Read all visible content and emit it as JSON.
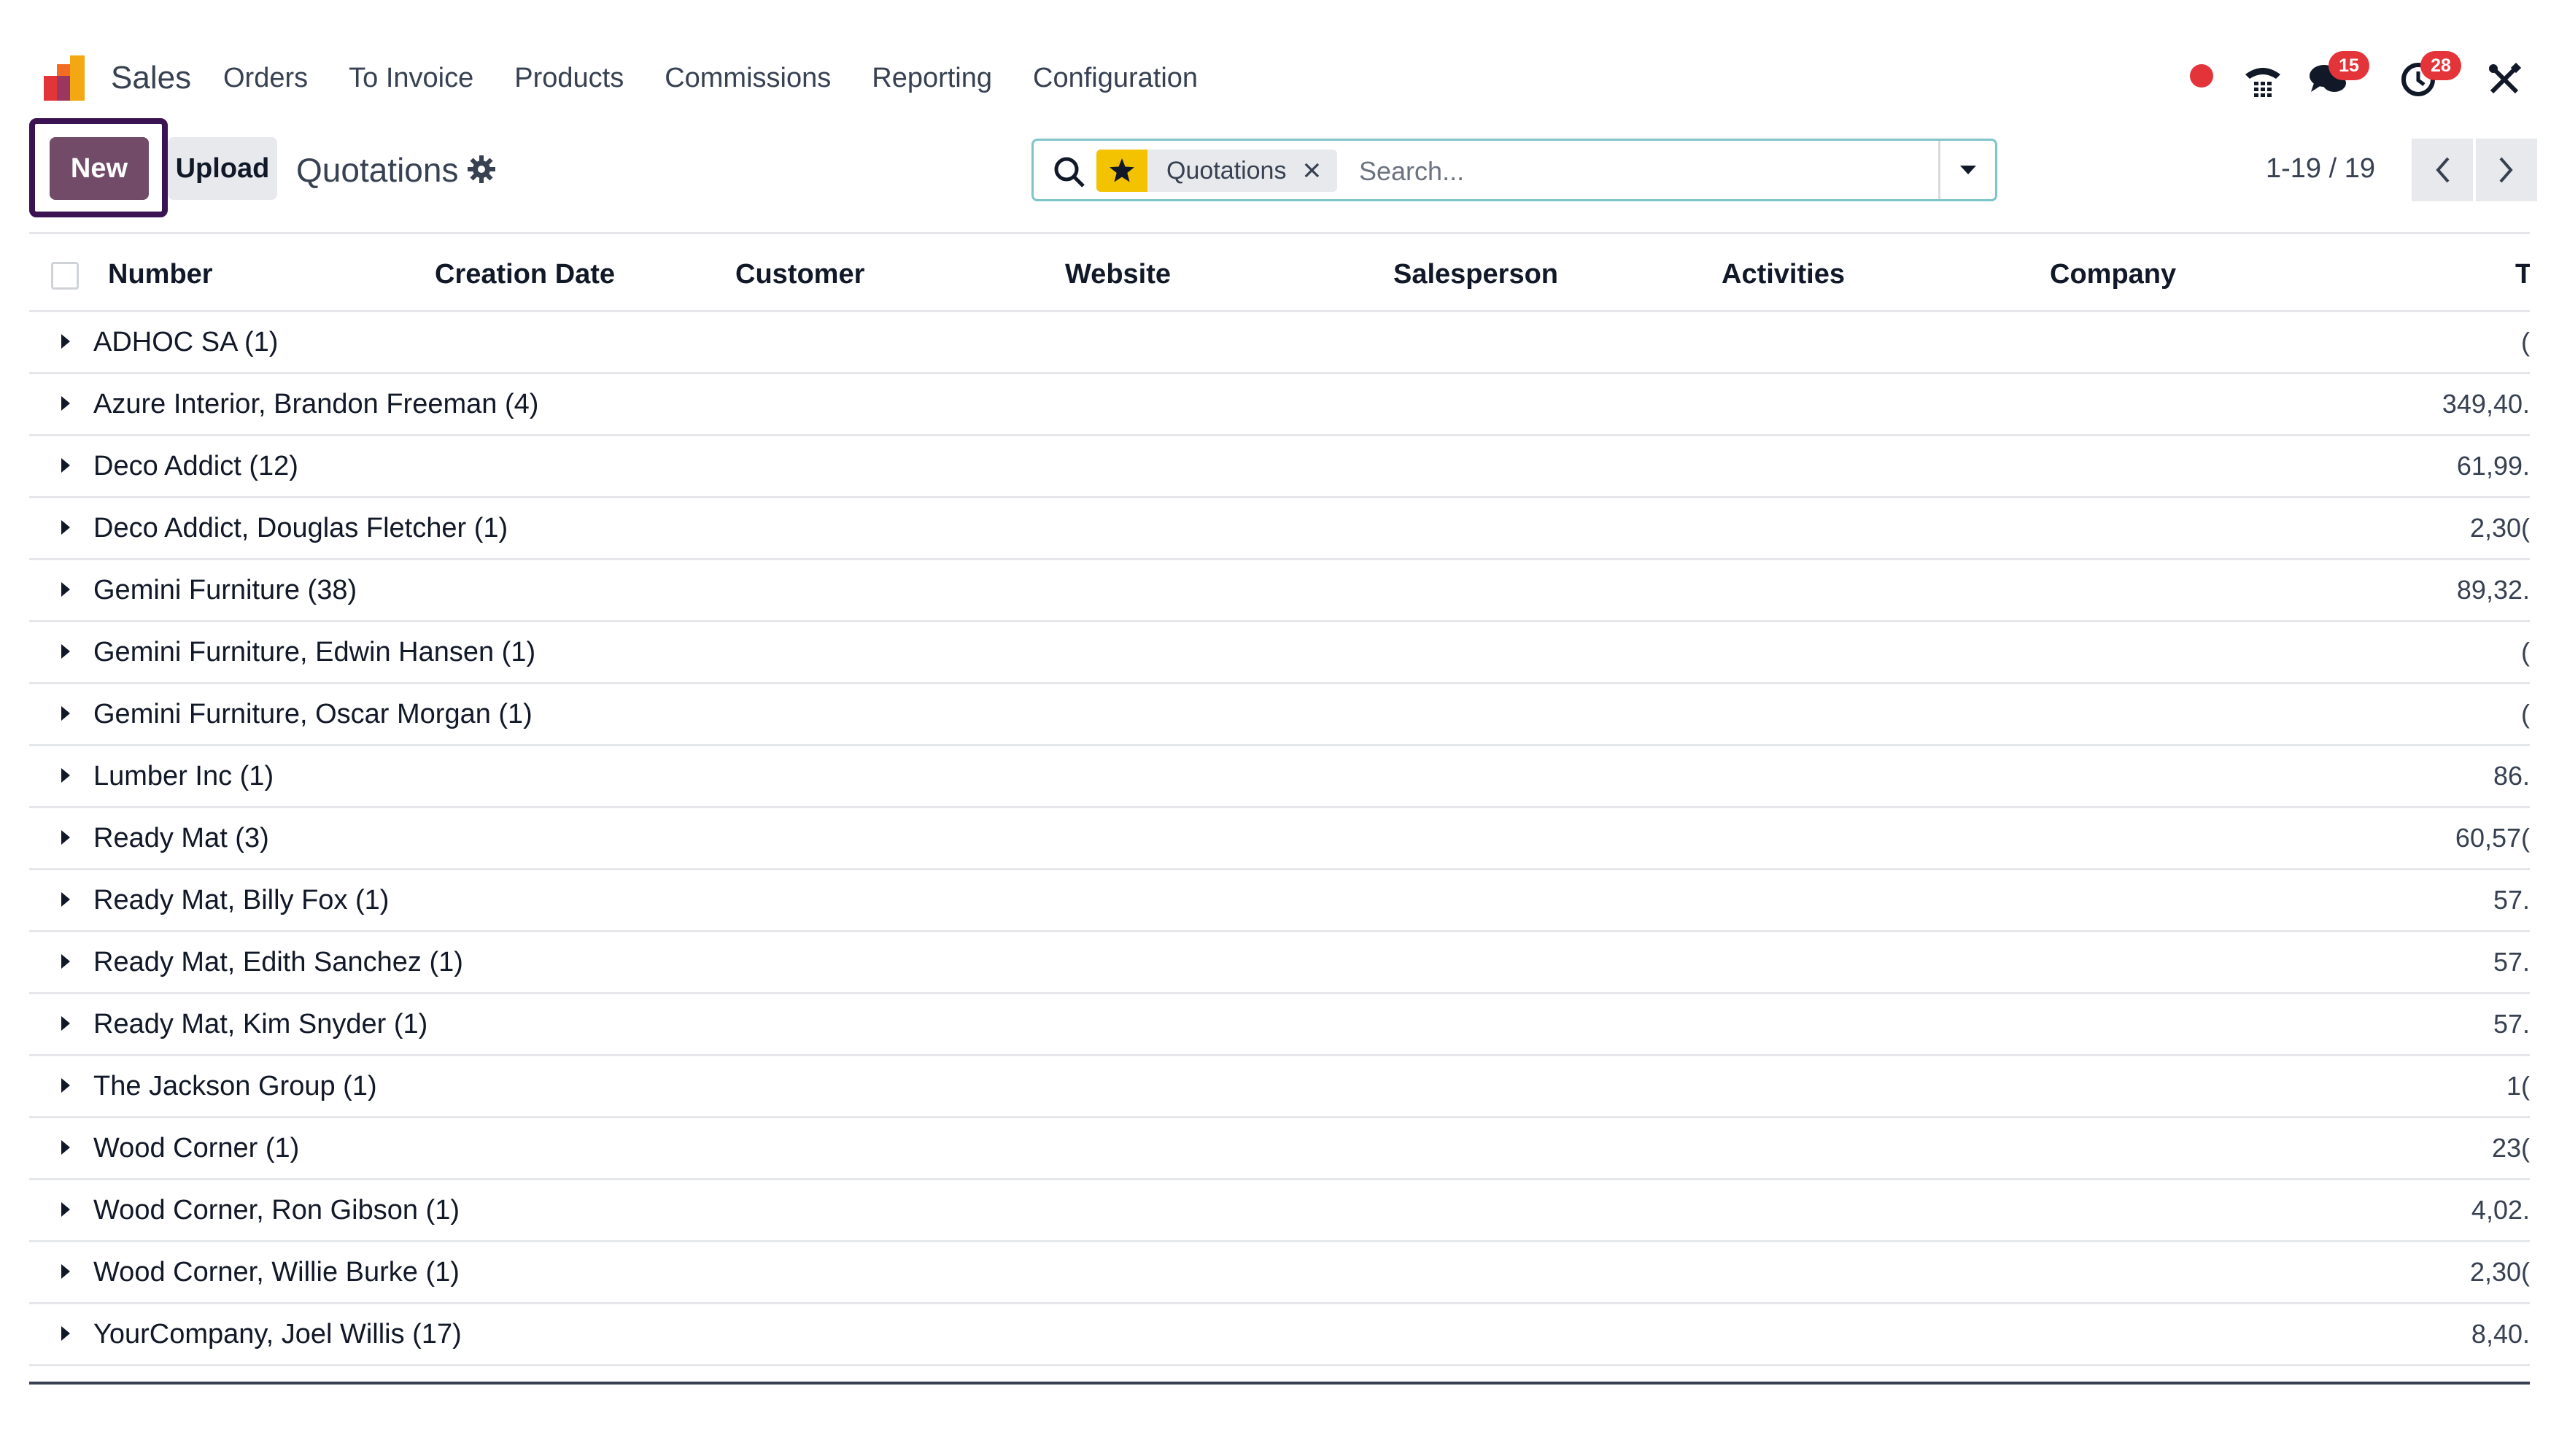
{
  "navbar": {
    "app_name": "Sales",
    "menu": [
      "Orders",
      "To Invoice",
      "Products",
      "Commissions",
      "Reporting",
      "Configuration"
    ],
    "messages_badge": "15",
    "activities_badge": "28",
    "icons": [
      "app-logo-icon",
      "record-dot-icon",
      "phone-icon",
      "chat-icon",
      "clock-icon",
      "tools-icon"
    ]
  },
  "control_panel": {
    "new_label": "New",
    "upload_label": "Upload",
    "title": "Quotations",
    "search": {
      "facet_label": "Quotations",
      "placeholder": "Search..."
    },
    "pager": "1-19 / 19"
  },
  "list": {
    "columns": [
      "Number",
      "Creation Date",
      "Customer",
      "Website",
      "Salesperson",
      "Activities",
      "Company",
      "T"
    ],
    "groups": [
      {
        "label": "ADHOC SA (1)",
        "total": "("
      },
      {
        "label": "Azure Interior, Brandon Freeman (4)",
        "total": "349,40."
      },
      {
        "label": "Deco Addict (12)",
        "total": "61,99."
      },
      {
        "label": "Deco Addict, Douglas Fletcher (1)",
        "total": "2,30("
      },
      {
        "label": "Gemini Furniture (38)",
        "total": "89,32."
      },
      {
        "label": "Gemini Furniture, Edwin Hansen (1)",
        "total": "("
      },
      {
        "label": "Gemini Furniture, Oscar Morgan (1)",
        "total": "("
      },
      {
        "label": "Lumber Inc (1)",
        "total": "86."
      },
      {
        "label": "Ready Mat (3)",
        "total": "60,57("
      },
      {
        "label": "Ready Mat, Billy Fox (1)",
        "total": "57."
      },
      {
        "label": "Ready Mat, Edith Sanchez (1)",
        "total": "57."
      },
      {
        "label": "Ready Mat, Kim Snyder (1)",
        "total": "57."
      },
      {
        "label": "The Jackson Group (1)",
        "total": "1("
      },
      {
        "label": "Wood Corner (1)",
        "total": "23("
      },
      {
        "label": "Wood Corner, Ron Gibson (1)",
        "total": "4,02."
      },
      {
        "label": "Wood Corner, Willie Burke (1)",
        "total": "2,30("
      },
      {
        "label": "YourCompany, Joel Willis (17)",
        "total": "8,40."
      }
    ]
  },
  "colors": {
    "primary": "#714b67",
    "focus_ring": "#3b1352",
    "badge": "#e3343a",
    "favorite": "#f3c301"
  }
}
